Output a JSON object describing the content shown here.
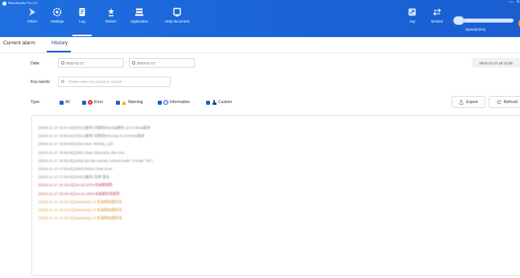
{
  "app": {
    "title": "RobotStudio Pro 4.5",
    "min_glyph": "—",
    "close_glyph": "✕"
  },
  "toolbar": {
    "items": [
      {
        "label": "CRSA",
        "icon": "cursor-icon"
      },
      {
        "label": "Settings",
        "icon": "gear-icon"
      },
      {
        "label": "Log",
        "icon": "document-icon"
      },
      {
        "label": "Dobot+",
        "icon": "robot-icon"
      },
      {
        "label": "Application",
        "icon": "application-icon"
      },
      {
        "label": "Help document",
        "icon": "help-document-icon"
      },
      {
        "label": "Jog",
        "icon": "jog-icon"
      },
      {
        "label": "Monitor",
        "icon": "monitor-icon"
      }
    ],
    "speed": {
      "label": "Speed(15%)",
      "value_percent": 15
    }
  },
  "tabs": {
    "current_alarm": "Current alarm",
    "history": "History"
  },
  "filters": {
    "date_label": "Date:",
    "start_date": "2023-11-17",
    "separator": "-",
    "end_date": "2023-11-17",
    "current_time": "2023-11-17 18:12:35",
    "keywords_label": "Key words:",
    "keywords_placeholder": "Please enter key words to search",
    "type_label": "Type:",
    "types": [
      {
        "label": "All",
        "checked": true
      },
      {
        "label": "Error",
        "checked": true
      },
      {
        "label": "Warning",
        "checked": true
      },
      {
        "label": "Information",
        "checked": true
      },
      {
        "label": "Custom",
        "checked": true
      }
    ],
    "export_label": "Export",
    "refresh_label": "Refresh"
  },
  "colors": {
    "accent": "#1a5ed0",
    "info_text": "#707a88",
    "error_text": "#c0485a",
    "warning_text": "#d6922e"
  },
  "logs": [
    {
      "level": "info",
      "text": "[2023-11-17 16:07:44] [info] [操作] 切换到dobotlg模块 v2.0.0-beta版本"
    },
    {
      "level": "info",
      "text": "[2023-11-17 16:06:42] [info] [操作] 切换到DHLong v2.0.0-beta版本"
    },
    {
      "level": "info",
      "text": "[2023-11-17 16:04:58] [info] save: blockly_123"
    },
    {
      "level": "info",
      "text": "[2023-11-17 16:00:45] [info] Clear Electronic skin tool"
    },
    {
      "level": "info",
      "text": "[2023-11-17 16:00:26] [info] Set the remote control mode: {\"mode\":\"tp\"}"
    },
    {
      "level": "info",
      "text": "[2023-11-17 17:56:42] [info] Robot Clear Error"
    },
    {
      "level": "info",
      "text": "[2023-11-17 17:56:20] [info] [操作] 急停 复位"
    },
    {
      "level": "error",
      "text": "[2023-11-17 16:19:43] [error] 2076:机械臂报警"
    },
    {
      "level": "error",
      "text": "[2023-11-17 16:19:40] [error] 1834:机械臂处理报警"
    },
    {
      "level": "warning",
      "text": "[2023-11-17 16:15:35] [warning] 1:6 机械臂碰撞检测"
    },
    {
      "level": "warning",
      "text": "[2023-11-17 16:12:22] [warning] 1:6 机械臂碰撞检测"
    },
    {
      "level": "warning",
      "text": "[2023-11-17 12:45:30] [warning] 1:3 机械臂碰撞检测"
    }
  ]
}
